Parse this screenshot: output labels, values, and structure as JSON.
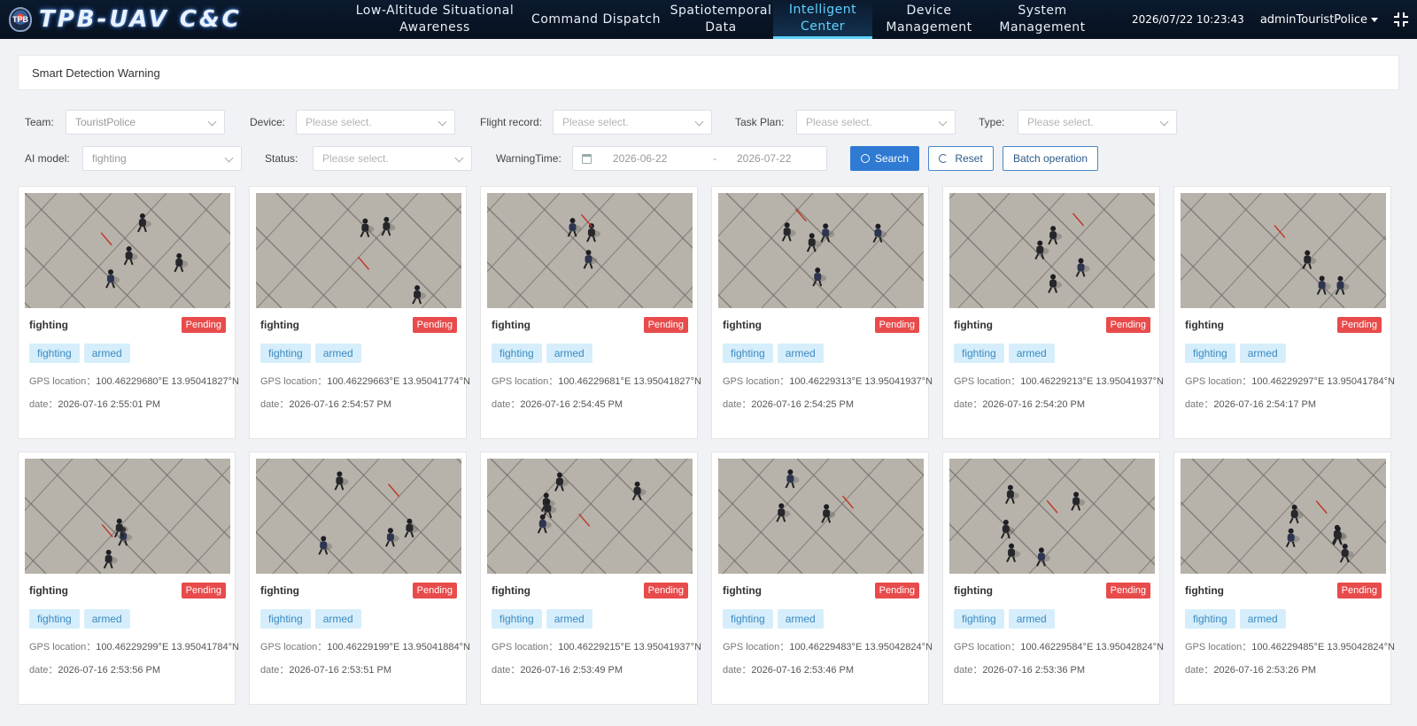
{
  "app": {
    "logo_text": "TPB-UAV C&C",
    "logo_badge": "TPB",
    "datetime": "2026/07/22 10:23:43",
    "user": "adminTouristPolice"
  },
  "nav": [
    {
      "label": "Low-Altitude Situational Awareness",
      "active": false
    },
    {
      "label": "Command Dispatch",
      "active": false
    },
    {
      "label": "Spatiotemporal Data",
      "active": false
    },
    {
      "label": "Intelligent Center",
      "active": true
    },
    {
      "label": "Device Management",
      "active": false
    },
    {
      "label": "System Management",
      "active": false
    }
  ],
  "page_title": "Smart Detection Warning",
  "filters": {
    "team_label": "Team:",
    "team_value": "TouristPolice",
    "device_label": "Device:",
    "device_placeholder": "Please select.",
    "flight_label": "Flight record:",
    "flight_placeholder": "Please select.",
    "task_label": "Task Plan:",
    "task_placeholder": "Please select.",
    "type_label": "Type:",
    "type_placeholder": "Please select.",
    "ai_label": "AI model:",
    "ai_value": "fighting",
    "status_label": "Status:",
    "status_placeholder": "Please select.",
    "time_label": "WarningTime:",
    "time_start": "2026-06-22",
    "time_sep": "-",
    "time_end": "2026-07-22"
  },
  "buttons": {
    "search": "Search",
    "reset": "Reset",
    "batch": "Batch operation"
  },
  "labels": {
    "gps": "GPS location：",
    "date": "date："
  },
  "cards": [
    {
      "title": "fighting",
      "status": "Pending",
      "tags": [
        "fighting",
        "armed"
      ],
      "gps": "100.46229680°E 13.95041827°N",
      "date": "2026-07-16 2:55:01 PM"
    },
    {
      "title": "fighting",
      "status": "Pending",
      "tags": [
        "fighting",
        "armed"
      ],
      "gps": "100.46229663°E 13.95041774°N",
      "date": "2026-07-16 2:54:57 PM"
    },
    {
      "title": "fighting",
      "status": "Pending",
      "tags": [
        "fighting",
        "armed"
      ],
      "gps": "100.46229681°E 13.95041827°N",
      "date": "2026-07-16 2:54:45 PM"
    },
    {
      "title": "fighting",
      "status": "Pending",
      "tags": [
        "fighting",
        "armed"
      ],
      "gps": "100.46229313°E 13.95041937°N",
      "date": "2026-07-16 2:54:25 PM"
    },
    {
      "title": "fighting",
      "status": "Pending",
      "tags": [
        "fighting",
        "armed"
      ],
      "gps": "100.46229213°E 13.95041937°N",
      "date": "2026-07-16 2:54:20 PM"
    },
    {
      "title": "fighting",
      "status": "Pending",
      "tags": [
        "fighting",
        "armed"
      ],
      "gps": "100.46229297°E 13.95041784°N",
      "date": "2026-07-16 2:54:17 PM"
    },
    {
      "title": "fighting",
      "status": "Pending",
      "tags": [
        "fighting",
        "armed"
      ],
      "gps": "100.46229299°E 13.95041784°N",
      "date": "2026-07-16 2:53:56 PM"
    },
    {
      "title": "fighting",
      "status": "Pending",
      "tags": [
        "fighting",
        "armed"
      ],
      "gps": "100.46229199°E 13.95041884°N",
      "date": "2026-07-16 2:53:51 PM"
    },
    {
      "title": "fighting",
      "status": "Pending",
      "tags": [
        "fighting",
        "armed"
      ],
      "gps": "100.46229215°E 13.95041937°N",
      "date": "2026-07-16 2:53:49 PM"
    },
    {
      "title": "fighting",
      "status": "Pending",
      "tags": [
        "fighting",
        "armed"
      ],
      "gps": "100.46229483°E 13.95042824°N",
      "date": "2026-07-16 2:53:46 PM"
    },
    {
      "title": "fighting",
      "status": "Pending",
      "tags": [
        "fighting",
        "armed"
      ],
      "gps": "100.46229584°E 13.95042824°N",
      "date": "2026-07-16 2:53:36 PM"
    },
    {
      "title": "fighting",
      "status": "Pending",
      "tags": [
        "fighting",
        "armed"
      ],
      "gps": "100.46229485°E 13.95042824°N",
      "date": "2026-07-16 2:53:26 PM"
    }
  ],
  "colors": {
    "header_bg": "#07111f",
    "nav_active": "#5fd2ff",
    "primary": "#2f7ad3",
    "pending": "#e84b4b",
    "tag_bg": "#d6eefb",
    "tag_text": "#3a8ac2"
  }
}
